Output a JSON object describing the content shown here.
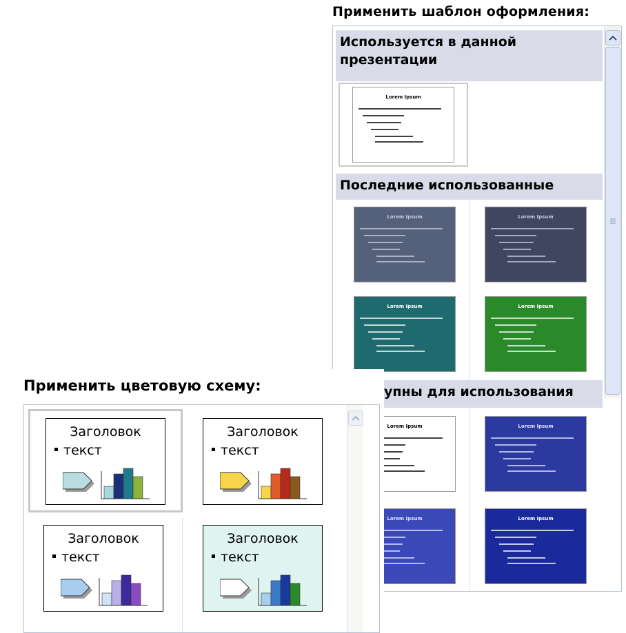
{
  "design_panel": {
    "title": "Применить шаблон оформления:",
    "groups": {
      "current": {
        "label": "Используется в данной презентации"
      },
      "recent": {
        "label": "Последние использованные"
      },
      "available": {
        "label": "Доступны для использования",
        "visible_label": "упны для использования"
      }
    },
    "thumbnails": {
      "current": [
        {
          "title": "Lorem Ipsum",
          "bg": "#ffffff",
          "text_color": "#000000"
        }
      ],
      "recent": [
        {
          "title": "Lorem Ipsum",
          "bg": "#55607a",
          "text_color": "#c8cce0"
        },
        {
          "title": "Lorem Ipsum",
          "bg": "#3f4660",
          "text_color": "#c8cce0"
        },
        {
          "title": "Lorem Ipsum",
          "bg": "#1e6a6e",
          "text_color": "#ffffff"
        },
        {
          "title": "Lorem Ipsum",
          "bg": "#2a8a2a",
          "text_color": "#ffffff"
        }
      ],
      "available": [
        {
          "title": "Lorem Ipsum",
          "bg": "#ffffff",
          "text_color": "#000000"
        },
        {
          "title": "Lorem Ipsum",
          "bg": "#2c3aa0",
          "text_color": "#dfe4ff"
        },
        {
          "title": "Lorem Ipsum",
          "bg": "#3a48b8",
          "text_color": "#dfe4ff"
        },
        {
          "title": "Lorem Ipsum",
          "bg": "#1a2a9a",
          "text_color": "#ffffff"
        }
      ]
    }
  },
  "color_scheme_panel": {
    "title": "Применить цветовую схему:",
    "schemes": [
      {
        "heading": "Заголовок",
        "text": "текст",
        "card_bg": "#ffffff",
        "arrow": "#b9dde0",
        "bars": [
          "#a9d7dc",
          "#1e2f7a",
          "#1f7a8c",
          "#8db43a"
        ]
      },
      {
        "heading": "Заголовок",
        "text": "текст",
        "card_bg": "#ffffff",
        "arrow": "#f7d44a",
        "bars": [
          "#f7d44a",
          "#e05a2a",
          "#b52a1a",
          "#8a5a1a"
        ]
      },
      {
        "heading": "Заголовок",
        "text": "текст",
        "card_bg": "#ffffff",
        "arrow": "#a9cdee",
        "bars": [
          "#cfe3f7",
          "#b8b0e8",
          "#3d2a9a",
          "#8a4ac2"
        ]
      },
      {
        "heading": "Заголовок",
        "text": "текст",
        "card_bg": "#dff3f0",
        "arrow": "#ffffff",
        "bars": [
          "#a9cdee",
          "#3a7ac8",
          "#1a3a9a",
          "#2a8a2a"
        ]
      }
    ]
  },
  "colors": {
    "group_header_bg": "#d9dbe8",
    "panel_border": "#b5bfd0",
    "scroll_button": "#dde6f7"
  }
}
